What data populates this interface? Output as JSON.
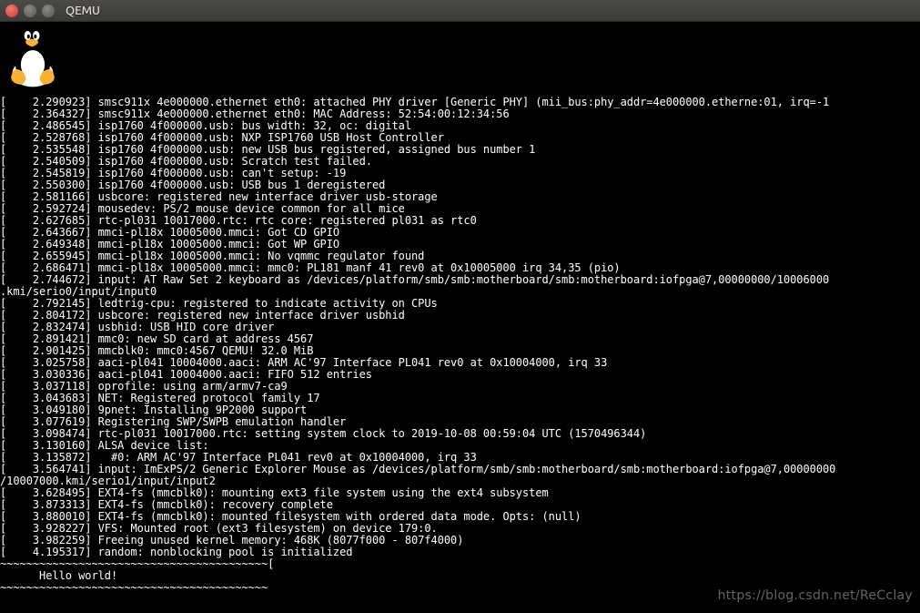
{
  "titlebar": {
    "title": "QEMU"
  },
  "watermark": "https://blog.csdn.net/ReCclay",
  "log_lines": [
    "[    2.290923] smsc911x 4e000000.ethernet eth0: attached PHY driver [Generic PHY] (mii_bus:phy_addr=4e000000.etherne:01, irq=-1",
    "[    2.364327] smsc911x 4e000000.ethernet eth0: MAC Address: 52:54:00:12:34:56",
    "[    2.486545] isp1760 4f000000.usb: bus width: 32, oc: digital",
    "[    2.528768] isp1760 4f000000.usb: NXP ISP1760 USB Host Controller",
    "[    2.535548] isp1760 4f000000.usb: new USB bus registered, assigned bus number 1",
    "[    2.540509] isp1760 4f000000.usb: Scratch test failed.",
    "[    2.545819] isp1760 4f000000.usb: can't setup: -19",
    "[    2.550300] isp1760 4f000000.usb: USB bus 1 deregistered",
    "[    2.581166] usbcore: registered new interface driver usb-storage",
    "[    2.592724] mousedev: PS/2 mouse device common for all mice",
    "[    2.627685] rtc-pl031 10017000.rtc: rtc core: registered pl031 as rtc0",
    "[    2.643667] mmci-pl18x 10005000.mmci: Got CD GPIO",
    "[    2.649348] mmci-pl18x 10005000.mmci: Got WP GPIO",
    "[    2.655945] mmci-pl18x 10005000.mmci: No vqmmc regulator found",
    "[    2.686471] mmci-pl18x 10005000.mmci: mmc0: PL181 manf 41 rev0 at 0x10005000 irq 34,35 (pio)",
    "[    2.744672] input: AT Raw Set 2 keyboard as /devices/platform/smb/smb:motherboard/smb:motherboard:iofpga@7,00000000/10006000",
    ".kmi/serio0/input/input0",
    "[    2.792145] ledtrig-cpu: registered to indicate activity on CPUs",
    "[    2.804172] usbcore: registered new interface driver usbhid",
    "[    2.832474] usbhid: USB HID core driver",
    "[    2.891421] mmc0: new SD card at address 4567",
    "[    2.901425] mmcblk0: mmc0:4567 QEMU! 32.0 MiB",
    "[    3.025758] aaci-pl041 10004000.aaci: ARM AC'97 Interface PL041 rev0 at 0x10004000, irq 33",
    "[    3.030336] aaci-pl041 10004000.aaci: FIFO 512 entries",
    "[    3.037118] oprofile: using arm/armv7-ca9",
    "[    3.043683] NET: Registered protocol family 17",
    "[    3.049180] 9pnet: Installing 9P2000 support",
    "[    3.077619] Registering SWP/SWPB emulation handler",
    "[    3.098474] rtc-pl031 10017000.rtc: setting system clock to 2019-10-08 00:59:04 UTC (1570496344)",
    "[    3.130160] ALSA device list:",
    "[    3.135872]   #0: ARM AC'97 Interface PL041 rev0 at 0x10004000, irq 33",
    "[    3.564741] input: ImExPS/2 Generic Explorer Mouse as /devices/platform/smb/smb:motherboard/smb:motherboard:iofpga@7,00000000",
    "/10007000.kmi/serio1/input/input2",
    "[    3.628495] EXT4-fs (mmcblk0): mounting ext3 file system using the ext4 subsystem",
    "[    3.873313] EXT4-fs (mmcblk0): recovery complete",
    "[    3.880010] EXT4-fs (mmcblk0): mounted filesystem with ordered data mode. Opts: (null)",
    "[    3.928227] VFS: Mounted root (ext3 filesystem) on device 179:0.",
    "[    3.982259] Freeing unused kernel memory: 468K (8077f000 - 807f4000)",
    "[    4.195317] random: nonblocking pool is initialized",
    "~~~~~~~~~~~~~~~~~~~~~~~~~~~~~~~~~~~~~~~~~[",
    "      Hello world!",
    "~~~~~~~~~~~~~~~~~~~~~~~~~~~~~~~~~~~~~~~~~"
  ]
}
